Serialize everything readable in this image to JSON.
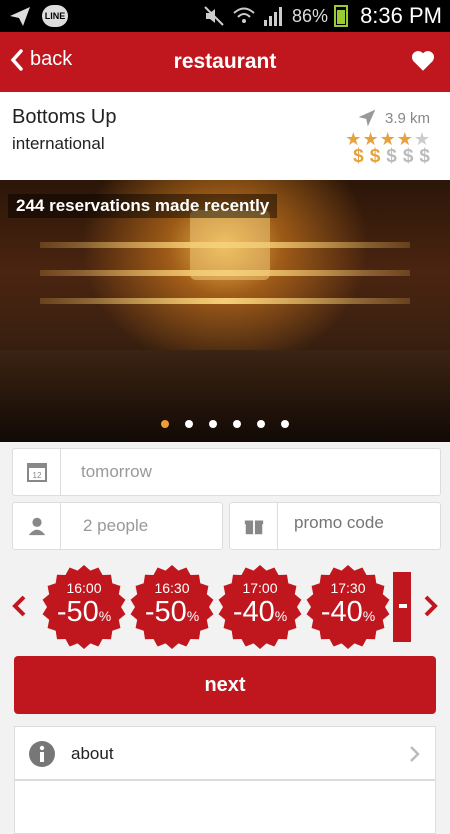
{
  "status_bar": {
    "battery": "86%",
    "time": "8:36 PM",
    "app_badge": "LINE"
  },
  "header": {
    "back_label": "back",
    "title": "restaurant"
  },
  "restaurant": {
    "name": "Bottoms Up",
    "category": "international",
    "distance": "3.9 km",
    "rating_stars": 4,
    "price_level": 2
  },
  "photo": {
    "banner": "244 reservations made recently",
    "page_count": 6,
    "active_page": 0
  },
  "form": {
    "date_value": "tomorrow",
    "people_value": "2  people",
    "promo_placeholder": "promo code"
  },
  "time_slots": [
    {
      "time": "16:00",
      "discount": "-50",
      "unit": "%"
    },
    {
      "time": "16:30",
      "discount": "-50",
      "unit": "%"
    },
    {
      "time": "17:00",
      "discount": "-40",
      "unit": "%"
    },
    {
      "time": "17:30",
      "discount": "-40",
      "unit": "%"
    }
  ],
  "next_label": "next",
  "menu": {
    "about_label": "about"
  },
  "colors": {
    "brand_red": "#c0161e",
    "star_gold": "#e6a23c",
    "active_dot": "#f0a030"
  }
}
